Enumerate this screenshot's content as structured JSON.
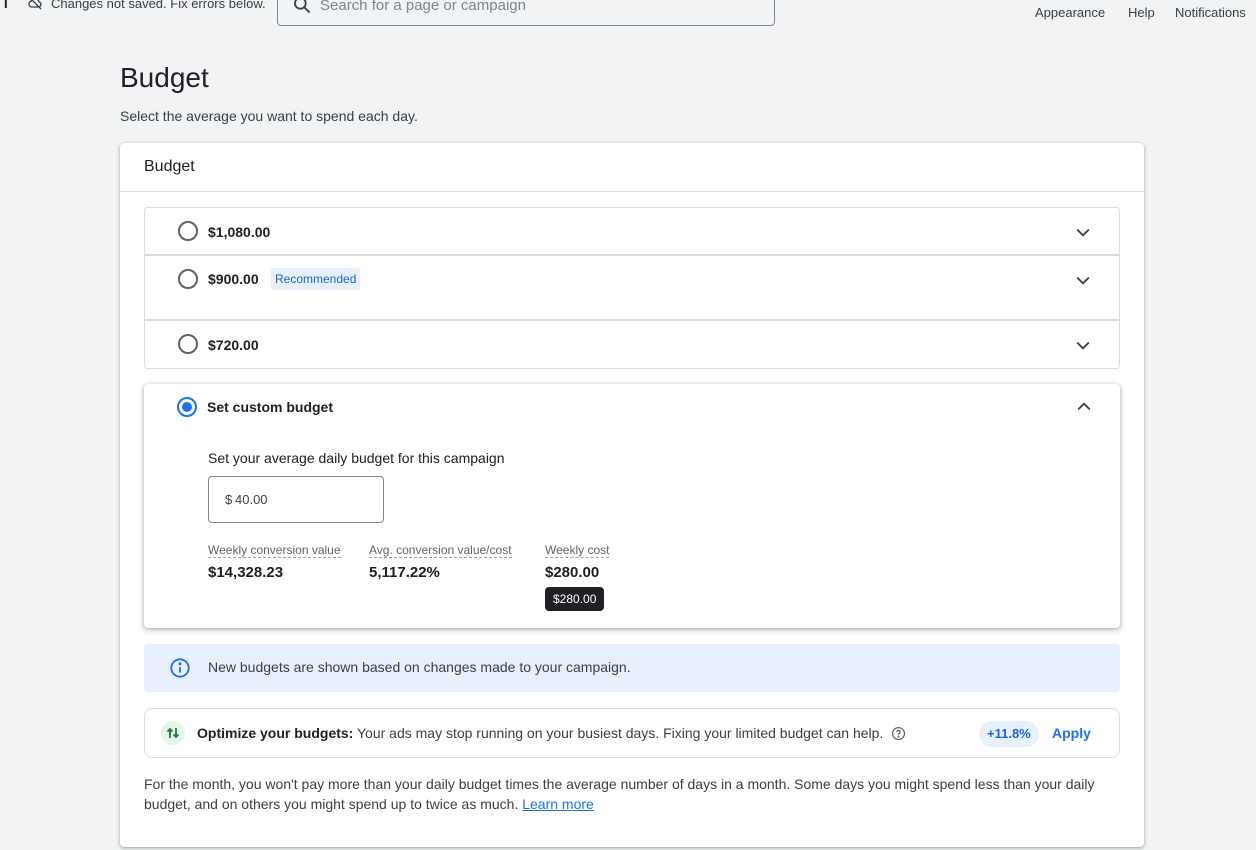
{
  "topbar": {
    "clipped_char": "n",
    "status_text": "Changes not saved. Fix errors below.",
    "search_placeholder": "Search for a page or campaign",
    "links": [
      "Appearance",
      "Help",
      "Notifications"
    ]
  },
  "page": {
    "title": "Budget",
    "subtitle": "Select the average you want to spend each day."
  },
  "card": {
    "title": "Budget",
    "options": [
      {
        "label": "$1,080.00",
        "selected": false
      },
      {
        "label": "$900.00",
        "badge": "Recommended",
        "selected": false
      },
      {
        "label": "$720.00",
        "selected": false
      }
    ],
    "custom": {
      "label": "Set custom budget",
      "selected": true,
      "prompt": "Set your average daily budget for this campaign",
      "currency": "$",
      "amount": "40.00",
      "metrics": [
        {
          "label": "Weekly conversion value",
          "value": "$14,328.23"
        },
        {
          "label": "Avg. conversion value/cost",
          "value": "5,117.22%"
        },
        {
          "label": "Weekly cost",
          "value": "$280.00"
        }
      ],
      "tooltip": "$280.00"
    },
    "info_banner": "New budgets are shown based on changes made to your campaign.",
    "optimize": {
      "heading": "Optimize your budgets:",
      "text": " Your ads may stop running on your busiest days. Fixing your limited budget can help.",
      "uplift": "+11.8%",
      "apply_label": "Apply"
    },
    "footnote": {
      "text": "For the month, you won't pay more than your daily budget times the average number of days in a month. Some days you might spend less than your daily budget, and on others you might spend up to twice as much. ",
      "link": "Learn more"
    }
  },
  "colors": {
    "accent": "#1a73e8",
    "badge_bg": "#e8f0fe",
    "info_bg": "#e8f0fe",
    "optimize_icon_bg": "#e6f4ea",
    "optimize_icon": "#188038"
  },
  "icons": {
    "status": "cloud-off-icon",
    "search": "search-icon",
    "expand": "chevron-down-icon",
    "collapse": "chevron-up-icon",
    "info": "info-icon",
    "optimize": "trending-arrows-icon",
    "help": "help-circle-icon"
  }
}
